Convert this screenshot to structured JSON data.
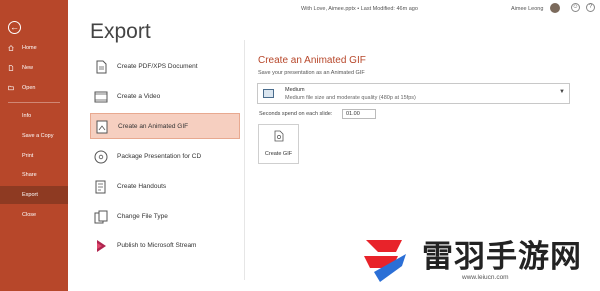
{
  "sidebar": {
    "items": [
      {
        "label": "Home",
        "icon": "home-icon"
      },
      {
        "label": "New",
        "icon": "new-document-icon"
      },
      {
        "label": "Open",
        "icon": "folder-icon"
      },
      {
        "label": "Info"
      },
      {
        "label": "Save a Copy"
      },
      {
        "label": "Print"
      },
      {
        "label": "Share"
      },
      {
        "label": "Export"
      },
      {
        "label": "Close"
      }
    ],
    "active": "Export",
    "back_icon": "back-arrow-icon"
  },
  "titlebar": {
    "title": "With Love, Aimee.pptx  •  Last Modified: 46m ago",
    "user_name": "Aimee Leong",
    "icons": [
      "smiley-icon",
      "help-icon"
    ]
  },
  "page": {
    "title": "Export",
    "options": [
      {
        "label": "Create PDF/XPS Document",
        "icon": "pdf-document-icon"
      },
      {
        "label": "Create a Video",
        "icon": "video-icon"
      },
      {
        "label": "Create an Animated GIF",
        "icon": "animated-gif-icon"
      },
      {
        "label": "Package Presentation for CD",
        "icon": "cd-icon"
      },
      {
        "label": "Create Handouts",
        "icon": "handouts-icon"
      },
      {
        "label": "Change File Type",
        "icon": "change-file-type-icon"
      },
      {
        "label": "Publish to Microsoft Stream",
        "icon": "stream-icon"
      }
    ],
    "selected_option": "Create an Animated GIF"
  },
  "gif_panel": {
    "title": "Create an Animated GIF",
    "subtitle": "Save your presentation as an Animated GIF",
    "quality": {
      "name": "Medium",
      "description": "Medium file size and moderate quality (480p at 15fps)"
    },
    "seconds_label": "Seconds spend on each slide:",
    "seconds_value": "01.00",
    "create_button_label": "Create GIF"
  },
  "watermark": {
    "title": "雷羽手游网",
    "url": "www.leiucn.com"
  },
  "colors": {
    "sidebar": "#b7472a",
    "sidebar_active": "#8e3a22",
    "selected_option_bg": "#f6cfc0",
    "accent_text": "#b7472a"
  }
}
